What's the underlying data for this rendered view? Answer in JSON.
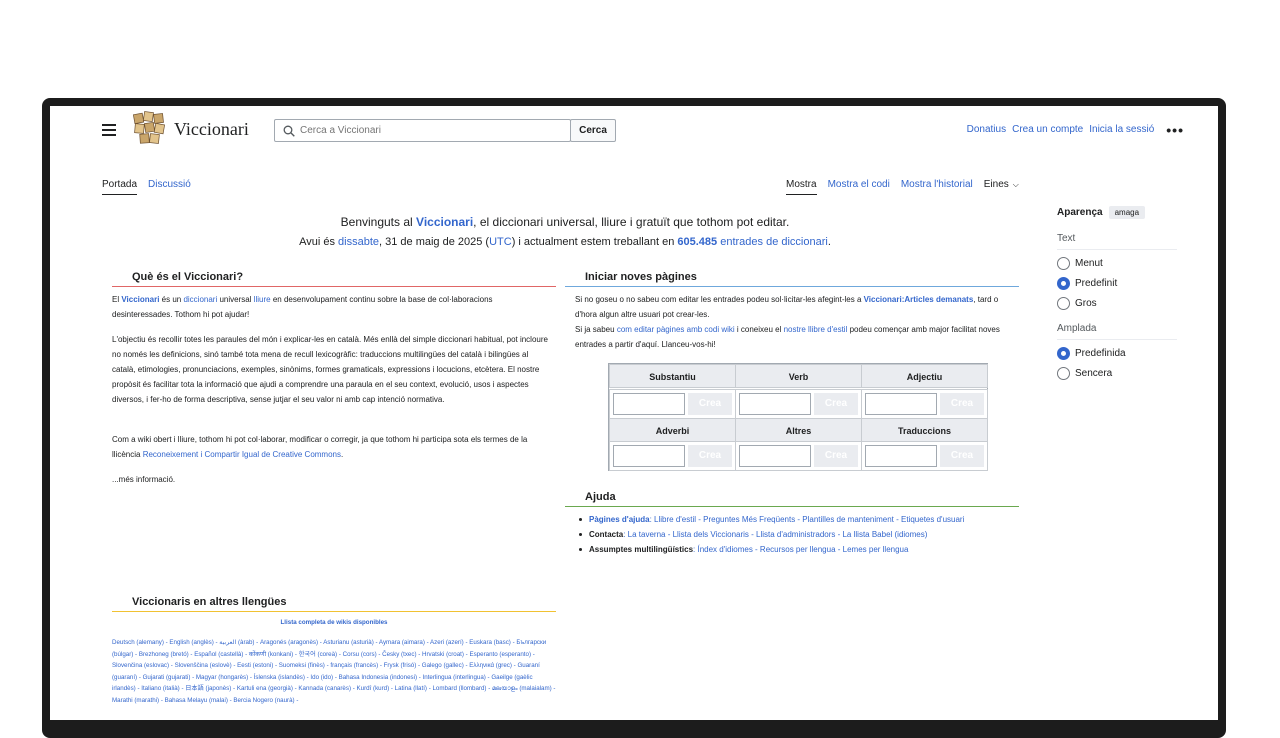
{
  "header": {
    "site_name": "Viccionari",
    "search_placeholder": "Cerca a Viccionari",
    "search_button": "Cerca",
    "user_links": [
      "Donatius",
      "Crea un compte",
      "Inicia la sessió"
    ]
  },
  "tabs": {
    "left": [
      "Portada",
      "Discussió"
    ],
    "right": [
      "Mostra",
      "Mostra el codi",
      "Mostra l'historial"
    ],
    "tools": "Eines"
  },
  "welcome": {
    "l1_a": "Benvinguts al ",
    "l1_link": "Viccionari",
    "l1_b": ", el diccionari universal, lliure i gratuït que tothom pot editar.",
    "l2_a": "Avui és ",
    "l2_day": "dissabte",
    "l2_b": ", 31 de maig de 2025 (",
    "l2_utc": "UTC",
    "l2_c": ") i actualment estem treballant en ",
    "l2_count": "605.485",
    "l2_entries": "entrades de diccionari",
    "l2_end": "."
  },
  "about": {
    "title": "Què és el Viccionari?",
    "p1_a": "El ",
    "p1_b": "Viccionari",
    "p1_c": " és un ",
    "p1_d": "diccionari",
    "p1_e": " universal ",
    "p1_f": "lliure",
    "p1_g": " en desenvolupament continu sobre la base de col·laboracions desinteressades. Tothom hi pot ajudar!",
    "p2": "L'objectiu és recollir totes les paraules del món i explicar-les en català. Més enllà del simple diccionari habitual, pot incloure no només les definicions, sinó també tota mena de recull lexicogràfic: traduccions multilingües del català i bilingües al català, etimologies, pronunciacions, exemples, sinònims, formes gramaticals, expressions i locucions, etcètera. El nostre propòsit és facilitar tota la informació que ajudi a comprendre una paraula en el seu context, evolució, usos i aspectes diversos, i fer-ho de forma descriptiva, sense jutjar el seu valor ni amb cap intenció normativa.",
    "p3_a": "Com a wiki obert i lliure, tothom hi pot col·laborar, modificar o corregir, ja que tothom hi participa sota els termes de la llicència ",
    "p3_link": "Reconeixement i Compartir Igual de Creative Commons",
    "p3_end": ".",
    "more": "...més informació."
  },
  "new_pages": {
    "title": "Iniciar noves pàgines",
    "p1_a": "Si no goseu o no sabeu com editar les entrades podeu sol·licitar-les afegint-les a ",
    "p1_link": "Viccionari:Articles demanats",
    "p1_b": ", tard o d'hora algun altre usuari pot crear-les.",
    "p2_a": "Si ja sabeu ",
    "p2_link1": "com editar pàgines amb codi wiki",
    "p2_b": " i coneixeu el ",
    "p2_link2": "nostre llibre d'estil",
    "p2_c": " podeu començar amb major facilitat noves entrades a partir d'aquí. Llanceu-vos-hi!",
    "headers": [
      "Substantiu",
      "Verb",
      "Adjectiu",
      "Adverbi",
      "Altres",
      "Traduccions"
    ],
    "create": "Crea"
  },
  "help": {
    "title": "Ajuda",
    "i1_label": "Pàgines d'ajuda",
    "i1_links": ": Llibre d'estil - Preguntes Més Freqüents - Plantilles de manteniment - Etiquetes d'usuari",
    "i2_label": "Contacta",
    "i2_links": ": La taverna - Llista dels Viccionaris - Llista d'administradors - La llista Babel (idiomes)",
    "i3_label": "Assumptes multilingüístics",
    "i3_links": ": Índex d'idiomes - Recursos per llengua - Lemes per llengua"
  },
  "other": {
    "title": "Viccionaris en altres llengües",
    "full_list": "Llista completa de wikis disponibles",
    "langs": "Deutsch (alemany) - English (anglès) - العربية (àrab) - Aragonés (aragonès) - Asturianu (asturià) - Aymara (aimara) - Azeri (azerí) - Euskara (basc) - Български (búlgar) - Brezhoneg (bretó) - Español (castellà) - कोंकणी (konkani) - 한국어 (coreà) - Corsu (cors) - Česky (txec) - Hrvatski (croat) - Esperanto (esperanto) - Slovenčina (eslovac) - Slovenščina (eslovè) - Eesti (estoni) - Suomeksi (finès) - français (francès) - Frysk (frisó) - Galego (gallec) - Ελληνικά (grec) - Guaraní (guaraní) - Gujarati (gujarati) - Magyar (hongarès) - Íslenska (islandès) - Ido (ido) - Bahasa Indonesia (indonesi) - Interlingua (interlingua) - Gaeilge (gaèlic irlandès) - Italiano (italià) - 日本語 (japonès) - Kartuli ena (georgià) - Kannada (canarès) - Kurdî (kurd) - Latina (llatí) - Lombard (llombard) - മലയാളം (malaialam) - Marathi (marathi) - Bahasa Melayu (malai) - Bercia Nogero (naurà) -"
  },
  "sidebar": {
    "title": "Aparença",
    "hide": "amaga",
    "text_label": "Text",
    "text_options": [
      "Menut",
      "Predefinit",
      "Gros"
    ],
    "width_label": "Amplada",
    "width_options": [
      "Predefinida",
      "Sencera"
    ],
    "selected_text": "Predefinit",
    "selected_width": "Predefinida"
  },
  "colors": {
    "link": "#3366cc",
    "about_rule": "#e06666",
    "new_rule": "#6fa8dc",
    "help_rule": "#6aa84f",
    "other_rule": "#f1c232"
  }
}
